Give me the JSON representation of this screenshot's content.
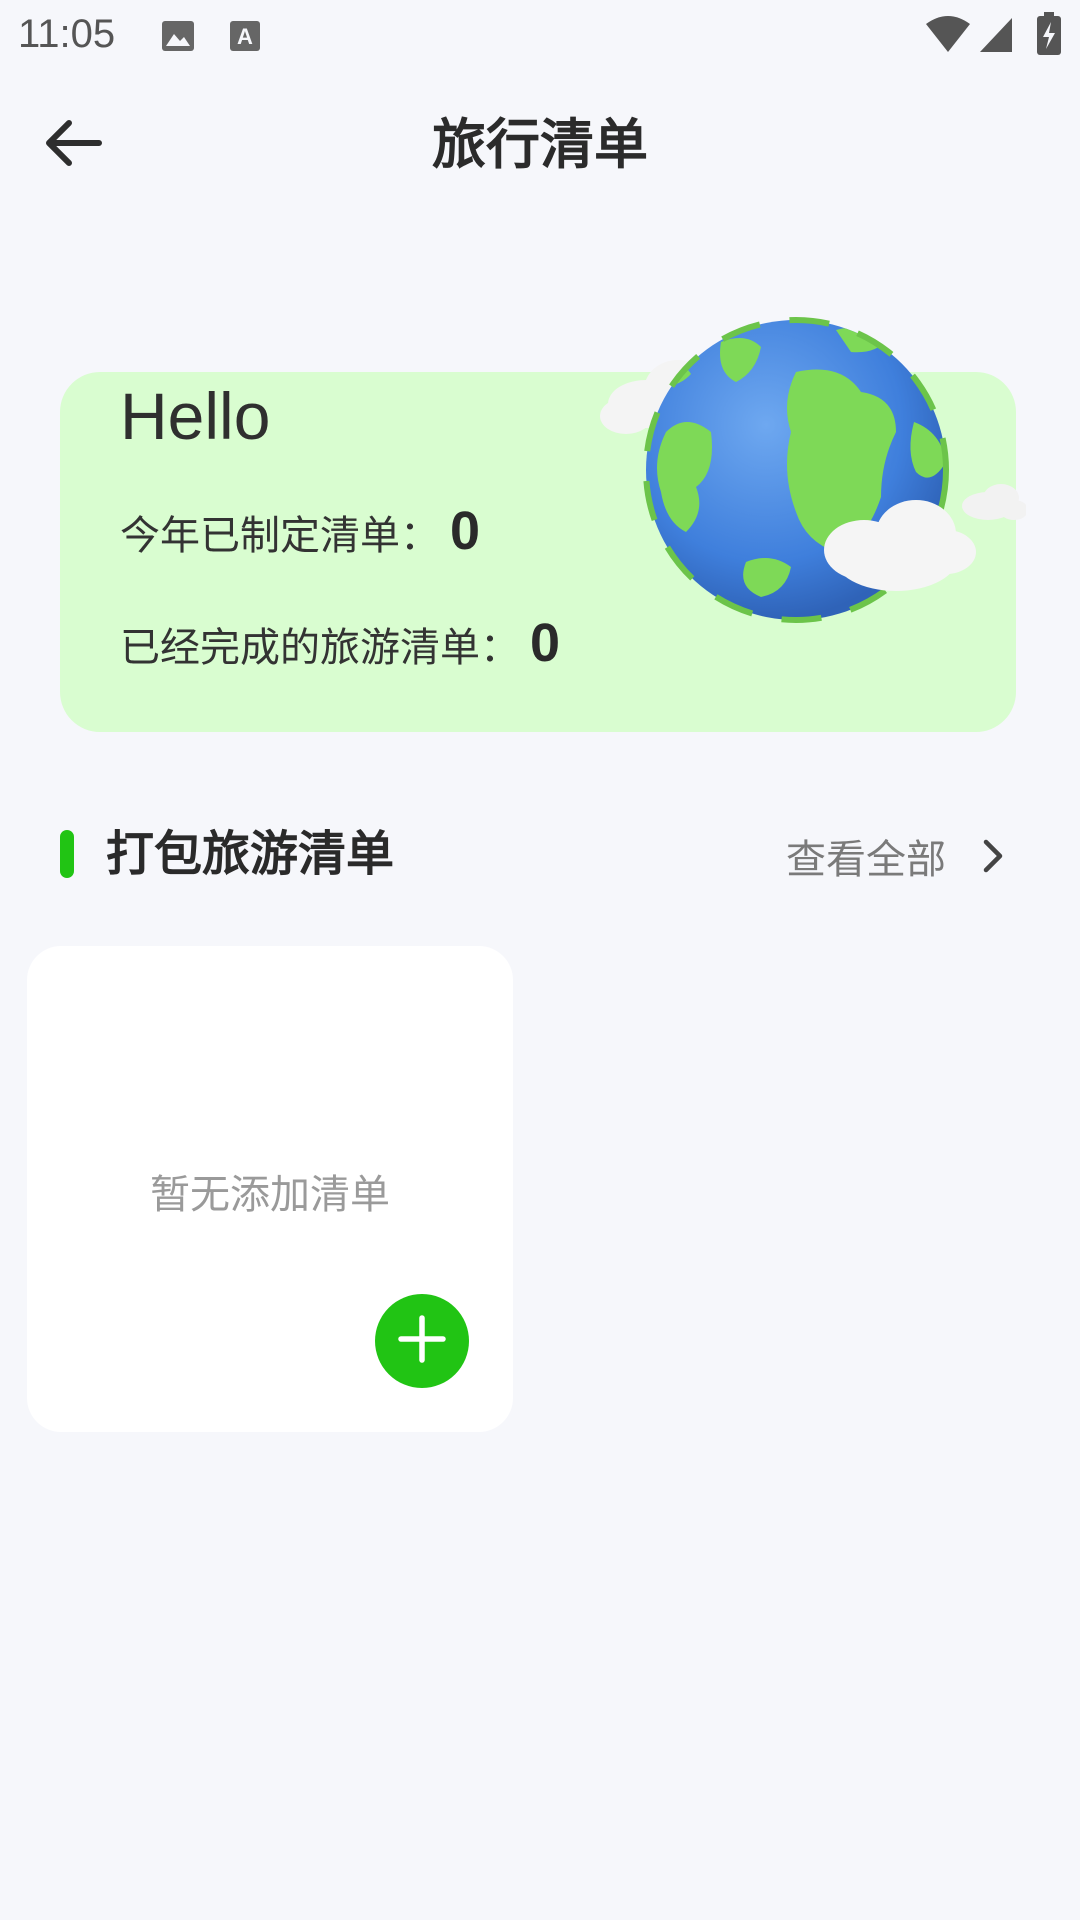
{
  "status_bar": {
    "time": "11:05",
    "icons": [
      "image-icon",
      "text-icon",
      "wifi-icon",
      "signal-icon",
      "battery-charging-icon"
    ]
  },
  "header": {
    "title": "旅行清单",
    "back_icon": "arrow-left-icon"
  },
  "summary": {
    "greeting": "Hello",
    "stats": [
      {
        "label": "今年已制定清单：",
        "value": "0"
      },
      {
        "label": "已经完成的旅游清单：",
        "value": "0"
      }
    ],
    "illustration": "globe-illustration",
    "colors": {
      "card_bg": "#d9fdd0"
    }
  },
  "section": {
    "title": "打包旅游清单",
    "view_all": "查看全部",
    "accent": "#21c414"
  },
  "list_card": {
    "empty_text": "暂无添加清单",
    "add_icon": "plus-icon"
  }
}
